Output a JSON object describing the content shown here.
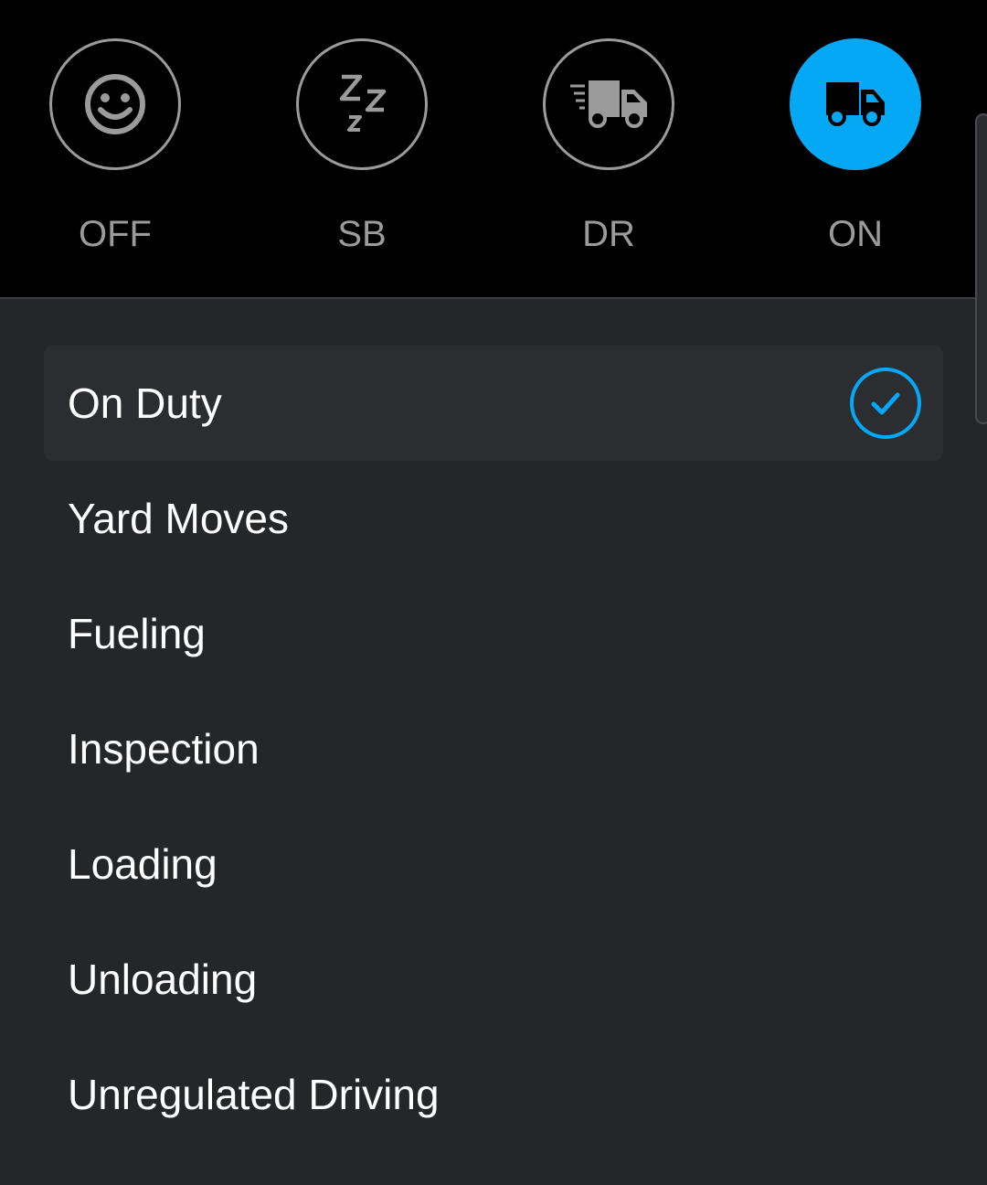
{
  "colors": {
    "accent": "#05a8f4",
    "inactive": "#9b9b9b",
    "background": "#252628",
    "header_background": "#000000",
    "text": "#ffffff"
  },
  "statuses": [
    {
      "label": "OFF",
      "icon": "smiley-icon",
      "active": false
    },
    {
      "label": "SB",
      "icon": "sleep-zzz-icon",
      "active": false
    },
    {
      "label": "DR",
      "icon": "moving-truck-icon",
      "active": false
    },
    {
      "label": "ON",
      "icon": "truck-icon",
      "active": true
    }
  ],
  "duty_options": [
    {
      "label": "On Duty",
      "selected": true
    },
    {
      "label": "Yard Moves",
      "selected": false
    },
    {
      "label": "Fueling",
      "selected": false
    },
    {
      "label": "Inspection",
      "selected": false
    },
    {
      "label": "Loading",
      "selected": false
    },
    {
      "label": "Unloading",
      "selected": false
    },
    {
      "label": "Unregulated Driving",
      "selected": false
    }
  ]
}
